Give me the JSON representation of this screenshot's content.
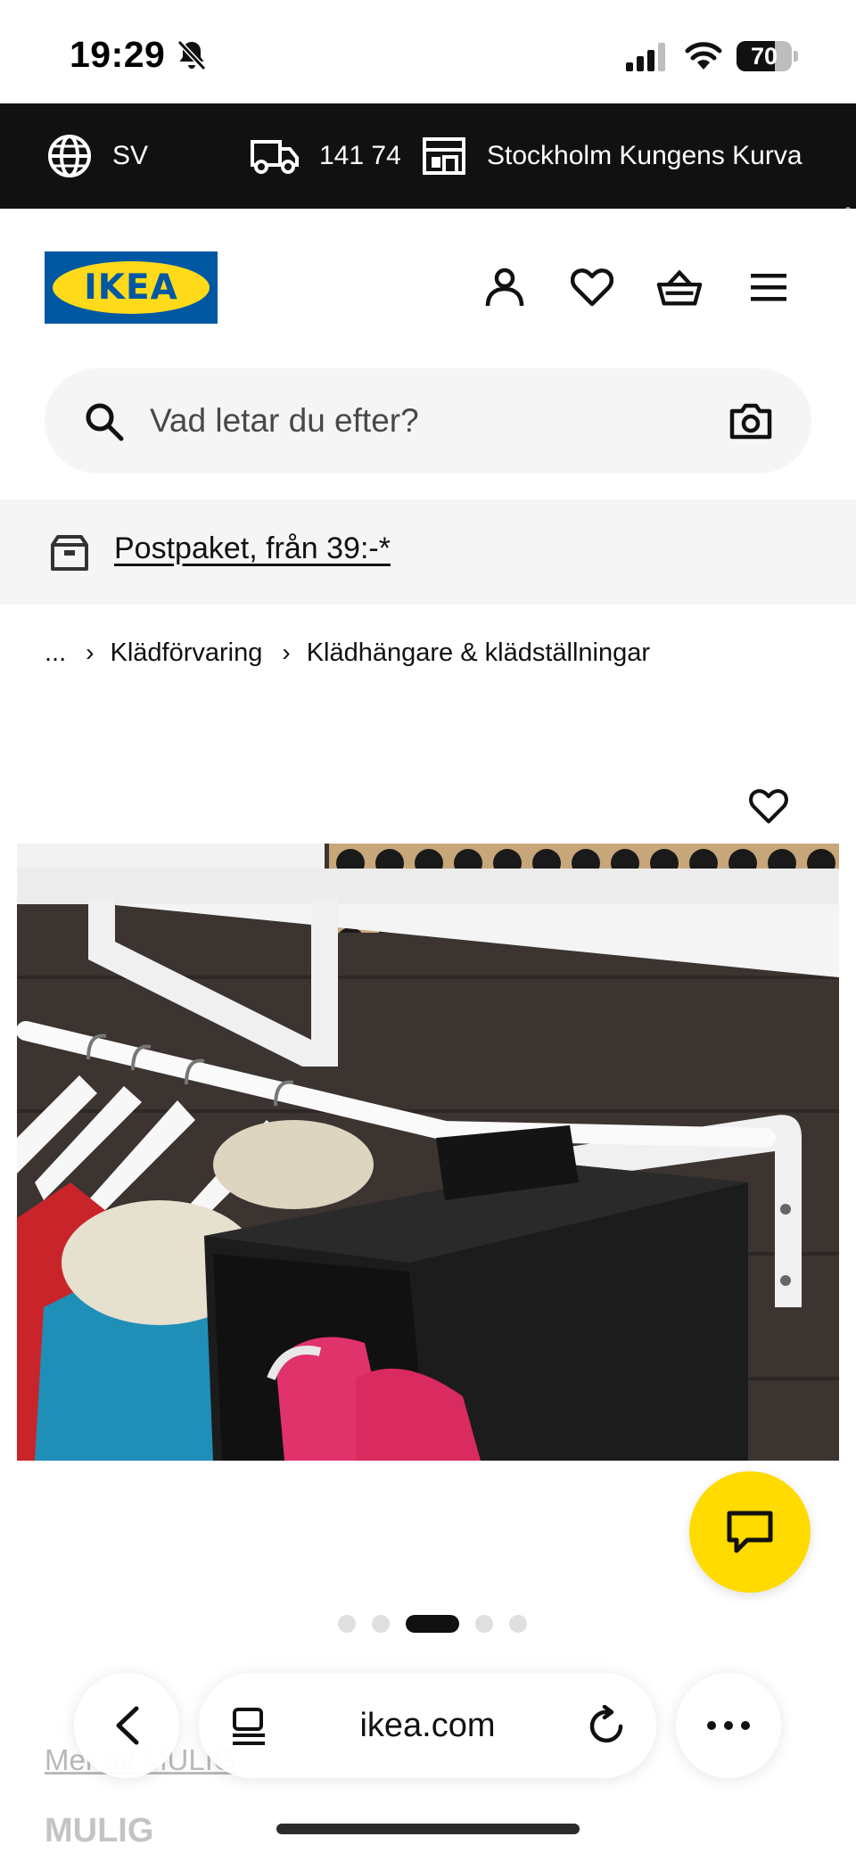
{
  "status_bar": {
    "time": "19:29",
    "battery_level": "70",
    "battery_fraction": 0.7
  },
  "top_bar": {
    "language": "SV",
    "postal_code": "141 74",
    "store": "Stockholm Kungens Kurva"
  },
  "header": {
    "logo_text": "IKEA",
    "brand_colors": {
      "blue": "#0058a3",
      "yellow": "#ffda1a"
    },
    "icons": [
      "profile-icon",
      "heart-icon",
      "basket-icon",
      "menu-icon"
    ]
  },
  "search": {
    "placeholder": "Vad letar du efter?"
  },
  "promo": {
    "label": "Postpaket, från 39:-*"
  },
  "breadcrumb": {
    "ellipsis": "...",
    "items": [
      "Klädförvaring",
      "Klädhängare & klädställningar"
    ]
  },
  "gallery": {
    "image_count": 5,
    "active_index": 2
  },
  "chat": {
    "color": "#ffdb00"
  },
  "below_fold": {
    "more_link": "Mer av MULIG",
    "product_name": "MULIG"
  },
  "browser": {
    "url": "ikea.com"
  }
}
